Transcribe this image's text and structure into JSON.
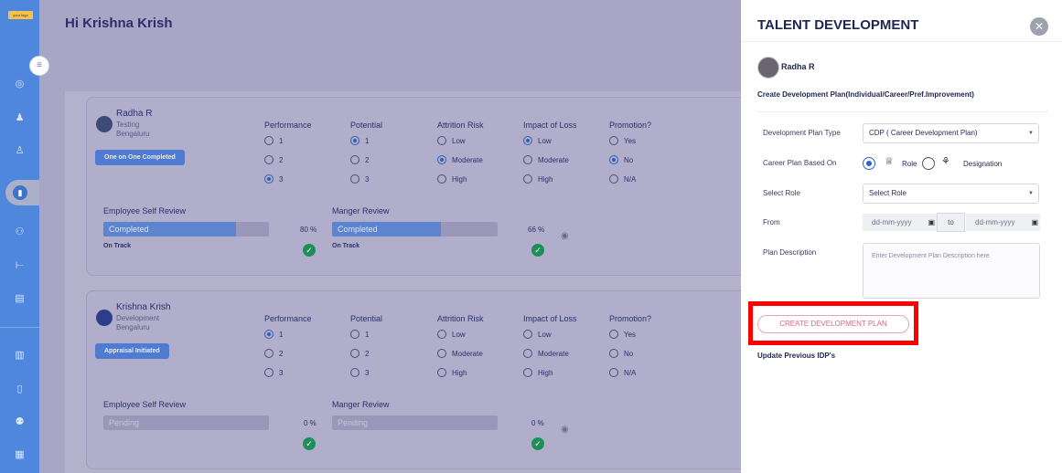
{
  "sidebar": {
    "logo_text": "your logo",
    "icons": [
      "chart-pie-icon",
      "team-icon",
      "person-icon",
      "book-icon",
      "handshake-icon",
      "hierarchy-icon",
      "document-icon",
      "report-icon",
      "book2-icon",
      "users-icon",
      "analytics-icon"
    ]
  },
  "main": {
    "greeting": "Hi Krishna Krish",
    "column_headers": [
      "Performance",
      "Potential",
      "Attrition Risk",
      "Impact of Loss",
      "Promotion?"
    ],
    "employees": [
      {
        "name": "Radha R",
        "department": "Testing",
        "location": "Bengaluru",
        "badge": "One on One Completed",
        "performance": [
          "1",
          "2",
          "3"
        ],
        "potential": [
          "1",
          "2",
          "3"
        ],
        "attrition": [
          "Low",
          "Moderate",
          "High"
        ],
        "impact": [
          "Low",
          "Moderate",
          "High"
        ],
        "promotion": [
          "Yes",
          "No",
          "N/A"
        ],
        "self_review_label": "Employee Self Review",
        "self_review_status": "Completed",
        "self_review_pct": "80 %",
        "self_review_progress": 0.8,
        "self_track": "On Track",
        "manager_review_label": "Manger Review",
        "manager_review_status": "Completed",
        "manager_review_pct": "66 %",
        "manager_review_progress": 0.66,
        "manager_track": "On Track"
      },
      {
        "name": "Krishna Krish",
        "department": "Development",
        "location": "Bengaluru",
        "badge": "Appraisal Initiated",
        "performance": [
          "1",
          "2",
          "3"
        ],
        "potential": [
          "1",
          "2",
          "3"
        ],
        "attrition": [
          "Low",
          "Moderate",
          "High"
        ],
        "impact": [
          "Low",
          "Moderate",
          "High"
        ],
        "promotion": [
          "Yes",
          "No",
          "N/A"
        ],
        "self_review_label": "Employee Self Review",
        "self_review_status": "Pending",
        "self_review_pct": "0 %",
        "self_review_progress": 0,
        "manager_review_label": "Manger Review",
        "manager_review_status": "Pending",
        "manager_review_pct": "0 %",
        "manager_review_progress": 0
      }
    ]
  },
  "drawer": {
    "title": "TALENT DEVELOPMENT",
    "employee_name": "Radha R",
    "subtitle": "Create Development Plan(Individual/Career/Pref.Improvement)",
    "plan_type_label": "Development Plan Type",
    "plan_type_value": "CDP ( Career Development Plan)",
    "based_on_label": "Career Plan Based On",
    "based_on_role": "Role",
    "based_on_designation": "Designation",
    "select_role_label": "Select Role",
    "select_role_value": "Select Role",
    "from_label": "From",
    "date_placeholder": "dd-mm-yyyy",
    "to_label": "to",
    "description_label": "Plan Description",
    "description_placeholder": "Enter Development Plan Description here",
    "create_button": "CREATE DEVELOPMENT PLAN",
    "update_link": "Update Previous IDP's"
  },
  "colors": {
    "sidebar": "#4f87dc",
    "overlay": "#a9a6c5",
    "highlight": "#ff0000",
    "accent_pink": "#e0628c"
  }
}
